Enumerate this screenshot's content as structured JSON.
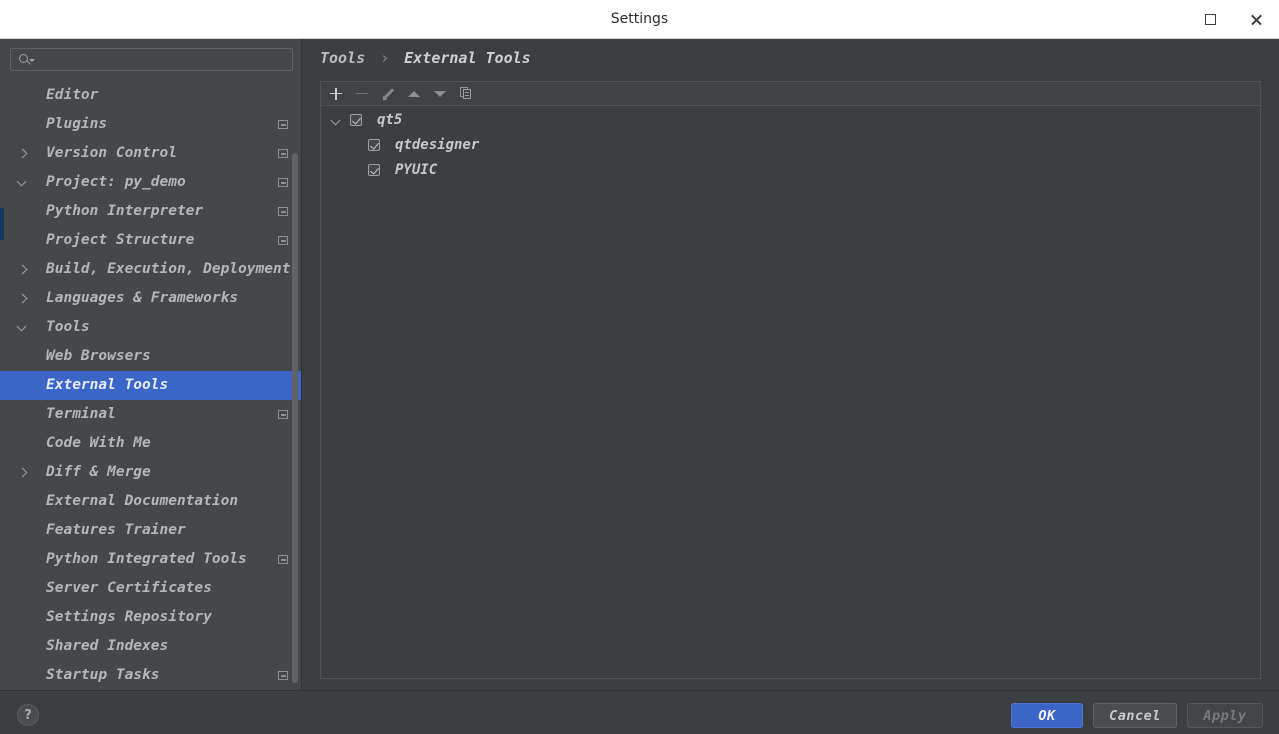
{
  "window": {
    "title": "Settings",
    "controls": {
      "maximize": "maximize-icon",
      "close": "close-icon"
    }
  },
  "colors": {
    "accent": "#3c65c8",
    "window_bg": "#3c3f41",
    "sidebar_bg": "#45484a",
    "titlebar_bg": "#ffffff",
    "text": "#b4b7ba",
    "selected_text": "#e6eaf2",
    "edge_marker": "#13365f"
  },
  "search": {
    "value": "",
    "placeholder": "",
    "icon": "search-icon"
  },
  "sidebar": {
    "items": [
      {
        "label": "Editor",
        "level": 0,
        "arrow": "none",
        "badge": false
      },
      {
        "label": "Plugins",
        "level": 0,
        "arrow": "none",
        "badge": true
      },
      {
        "label": "Version Control",
        "level": 0,
        "arrow": "right",
        "badge": true
      },
      {
        "label": "Project: py_demo",
        "level": 0,
        "arrow": "down",
        "badge": true
      },
      {
        "label": "Python Interpreter",
        "level": 1,
        "arrow": "none",
        "badge": true
      },
      {
        "label": "Project Structure",
        "level": 1,
        "arrow": "none",
        "badge": true
      },
      {
        "label": "Build, Execution, Deployment",
        "level": 0,
        "arrow": "right",
        "badge": false
      },
      {
        "label": "Languages & Frameworks",
        "level": 0,
        "arrow": "right",
        "badge": false
      },
      {
        "label": "Tools",
        "level": 0,
        "arrow": "down",
        "badge": false
      },
      {
        "label": "Web Browsers",
        "level": 1,
        "arrow": "none",
        "badge": false
      },
      {
        "label": "External Tools",
        "level": 1,
        "arrow": "none",
        "badge": false,
        "selected": true
      },
      {
        "label": "Terminal",
        "level": 1,
        "arrow": "none",
        "badge": true
      },
      {
        "label": "Code With Me",
        "level": 1,
        "arrow": "none",
        "badge": false
      },
      {
        "label": "Diff & Merge",
        "level": 1,
        "arrow": "right",
        "badge": false
      },
      {
        "label": "External Documentation",
        "level": 1,
        "arrow": "none",
        "badge": false
      },
      {
        "label": "Features Trainer",
        "level": 1,
        "arrow": "none",
        "badge": false
      },
      {
        "label": "Python Integrated Tools",
        "level": 1,
        "arrow": "none",
        "badge": true
      },
      {
        "label": "Server Certificates",
        "level": 1,
        "arrow": "none",
        "badge": false
      },
      {
        "label": "Settings Repository",
        "level": 1,
        "arrow": "none",
        "badge": false
      },
      {
        "label": "Shared Indexes",
        "level": 1,
        "arrow": "none",
        "badge": false
      },
      {
        "label": "Startup Tasks",
        "level": 1,
        "arrow": "none",
        "badge": true
      }
    ]
  },
  "content": {
    "breadcrumb": {
      "parent": "Tools",
      "separator": "›",
      "leaf": "External Tools"
    },
    "toolbar": [
      {
        "name": "add-button",
        "icon": "plus-icon",
        "enabled": true
      },
      {
        "name": "remove-button",
        "icon": "minus-icon",
        "enabled": false
      },
      {
        "name": "edit-button",
        "icon": "pencil-icon",
        "enabled": false
      },
      {
        "name": "move-up-button",
        "icon": "arrow-up-icon",
        "enabled": false
      },
      {
        "name": "move-down-button",
        "icon": "arrow-down-icon",
        "enabled": false
      },
      {
        "name": "copy-button",
        "icon": "copy-icon",
        "enabled": false
      }
    ],
    "tools_tree": [
      {
        "label": "qt5",
        "level": 0,
        "checked": true,
        "expanded": true
      },
      {
        "label": "qtdesigner",
        "level": 1,
        "checked": true
      },
      {
        "label": "PYUIC",
        "level": 1,
        "checked": true
      }
    ]
  },
  "footer": {
    "help": "?",
    "ok": "OK",
    "cancel": "Cancel",
    "apply": "Apply"
  }
}
